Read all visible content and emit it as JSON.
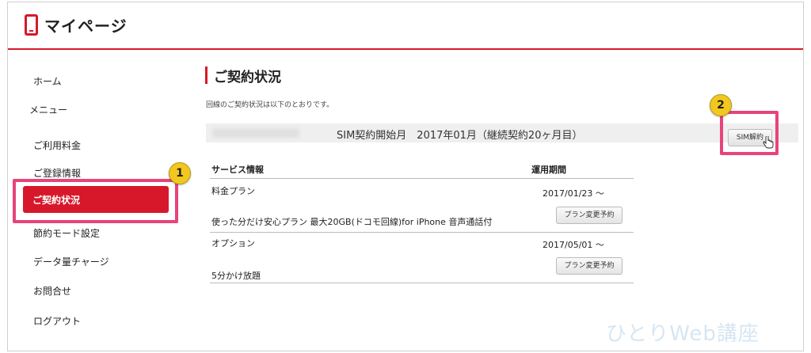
{
  "header": {
    "title": "マイページ",
    "logo_icon": "phone-icon",
    "accent": "#d7182a"
  },
  "sidebar": {
    "items": [
      {
        "label": "ホーム"
      },
      {
        "label": "メニュー"
      },
      {
        "label": "ご利用料金"
      },
      {
        "label": "ご登録情報"
      },
      {
        "label": "ご契約状況",
        "active": true
      },
      {
        "label": "節約モード設定"
      },
      {
        "label": "データ量チャージ"
      },
      {
        "label": "お問合せ"
      },
      {
        "label": "ログアウト"
      }
    ]
  },
  "annotations": {
    "badge1": "1",
    "badge2": "2",
    "highlight_color": "#e8437a"
  },
  "main": {
    "title": "ご契約状況",
    "description": "回線のご契約状況は以下のとおりです。",
    "sim_info": "SIM契約開始月　2017年01月（継続契約20ヶ月目）",
    "sim_cancel_button": "SIM解約",
    "table": {
      "headers": [
        "サービス情報",
        "運用期間"
      ],
      "rows": [
        {
          "category": "料金プラン",
          "date": "2017/01/23 〜",
          "name": "使った分だけ安心プラン 最大20GB(ドコモ回線)for iPhone 音声通話付",
          "button": "プラン変更予約"
        },
        {
          "category": "オプション",
          "date": "2017/05/01 〜",
          "name": "5分かけ放題",
          "button": "プラン変更予約"
        }
      ]
    }
  },
  "watermark": "ひとりWeb講座"
}
